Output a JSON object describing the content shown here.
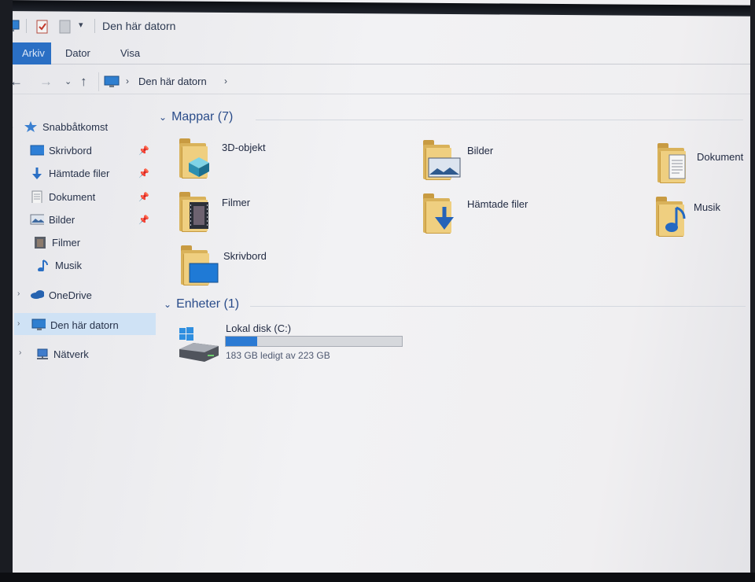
{
  "window": {
    "title": "Den här datorn"
  },
  "ribbon": {
    "tabs": [
      "Arkiv",
      "Dator",
      "Visa"
    ]
  },
  "address": {
    "path": "Den här datorn"
  },
  "navpane": {
    "quick_access": "Snabbåtkomst",
    "quick_items": [
      "Skrivbord",
      "Hämtade filer",
      "Dokument",
      "Bilder",
      "Filmer",
      "Musik"
    ],
    "onedrive": "OneDrive",
    "this_pc": "Den här datorn",
    "network": "Nätverk"
  },
  "content": {
    "folders_header": "Mappar (7)",
    "folders": [
      "3D-objekt",
      "Bilder",
      "Dokument",
      "Filmer",
      "Hämtade filer",
      "Musik",
      "Skrivbord"
    ],
    "devices_header": "Enheter (1)",
    "drive": {
      "name": "Lokal disk (C:)",
      "free_text": "183 GB ledigt av 223 GB",
      "used_fraction": 0.18
    }
  },
  "colors": {
    "accent": "#2a6fc4",
    "drive_bar": "#2b7ad3",
    "folder": "#efcf80"
  }
}
